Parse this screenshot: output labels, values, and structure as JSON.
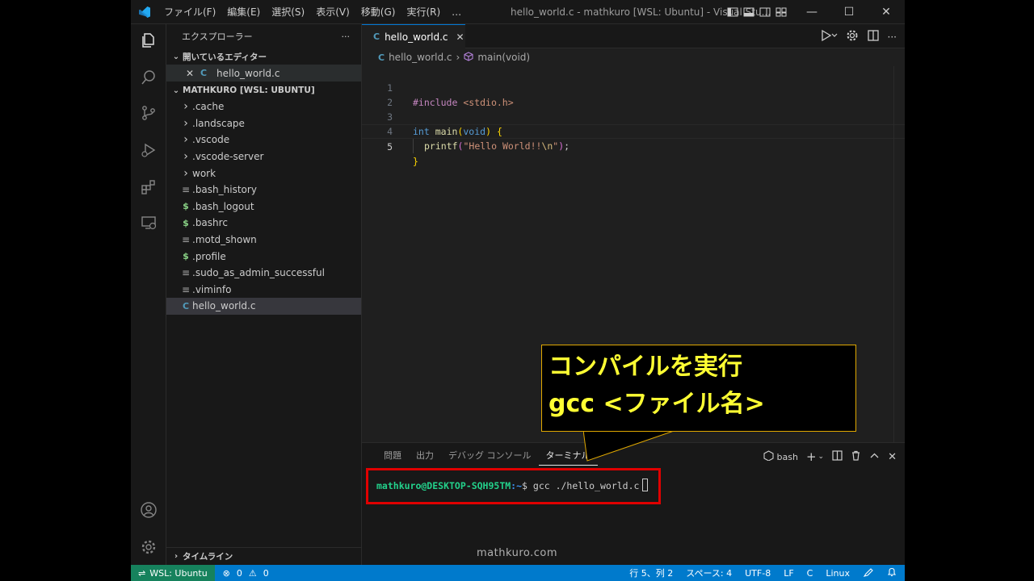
{
  "menu": [
    "ファイル(F)",
    "編集(E)",
    "選択(S)",
    "表示(V)",
    "移動(G)",
    "実行(R)",
    "…"
  ],
  "window_title": "hello_world.c - mathkuro [WSL: Ubuntu] - Visual Stu...",
  "sidebar": {
    "title": "エクスプローラー",
    "open_editors_label": "開いているエディター",
    "open_editor_file": "hello_world.c",
    "folder_label": "MATHKURO [WSL: UBUNTU]",
    "items": [
      {
        "name": ".cache",
        "type": "folder"
      },
      {
        "name": ".landscape",
        "type": "folder"
      },
      {
        "name": ".vscode",
        "type": "folder"
      },
      {
        "name": ".vscode-server",
        "type": "folder"
      },
      {
        "name": "work",
        "type": "folder"
      },
      {
        "name": ".bash_history",
        "type": "text"
      },
      {
        "name": ".bash_logout",
        "type": "shell"
      },
      {
        "name": ".bashrc",
        "type": "shell"
      },
      {
        "name": ".motd_shown",
        "type": "text"
      },
      {
        "name": ".profile",
        "type": "shell"
      },
      {
        "name": ".sudo_as_admin_successful",
        "type": "text"
      },
      {
        "name": ".viminfo",
        "type": "text"
      },
      {
        "name": "hello_world.c",
        "type": "c"
      }
    ],
    "timeline_label": "タイムライン"
  },
  "editor": {
    "tab_label": "hello_world.c",
    "breadcrumb_file": "hello_world.c",
    "breadcrumb_symbol": "main(void)",
    "line_numbers": [
      "1",
      "2",
      "3",
      "4",
      "5"
    ],
    "code": {
      "l1_pp": "#include",
      "l1_inc": "<stdio.h>",
      "l3_type": "int",
      "l3_fn": "main",
      "l3_paren_open": "(",
      "l3_void": "void",
      "l3_paren_close": ")",
      "l3_brace": "{",
      "l4_fn": "printf",
      "l4_paren_open": "(",
      "l4_str": "\"Hello World!!",
      "l4_esc": "\\n",
      "l4_str_end": "\"",
      "l4_paren_close": ")",
      "l4_semi": ";",
      "l5_brace": "}"
    }
  },
  "panel": {
    "tabs": [
      "問題",
      "出力",
      "デバッグ コンソール",
      "ターミナル"
    ],
    "active_tab": "ターミナル",
    "shell_label": "bash",
    "terminal": {
      "user_host": "mathkuro@DESKTOP-SQH95TM",
      "path": ":~",
      "prompt": "$",
      "command": " gcc ./hello_world.c"
    }
  },
  "status": {
    "remote": "WSL: Ubuntu",
    "errors": "0",
    "warnings": "0",
    "position": "行 5、列 2",
    "spaces": "スペース: 4",
    "encoding": "UTF-8",
    "eol": "LF",
    "language": "C",
    "platform": "Linux"
  },
  "callout": {
    "line1": "コンパイルを実行",
    "line2": "gcc <ファイル名>"
  },
  "watermark": "mathkuro.com",
  "colors": {
    "accent": "#0078d4",
    "status_bar": "#007acc",
    "remote": "#16825d",
    "highlight_box": "#e00000",
    "callout_text": "#ffff33"
  }
}
